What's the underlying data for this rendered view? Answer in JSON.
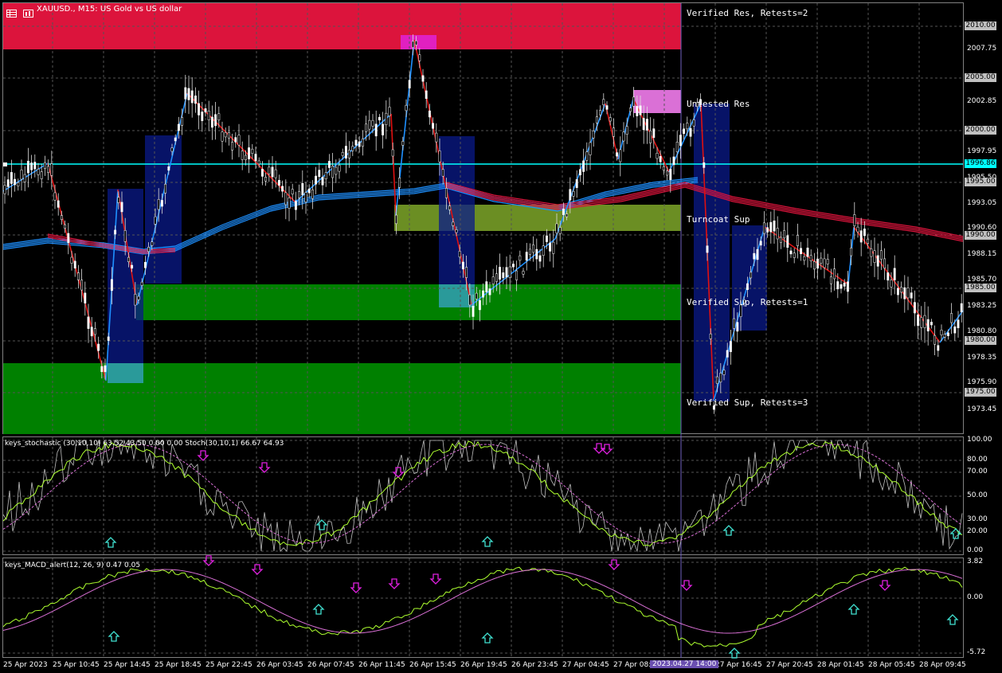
{
  "window": {
    "symbol_title": "XAUUSD., M15:  US Gold vs US dollar",
    "icon_grid": "table-icon",
    "icon_symbol": "chart-icon"
  },
  "colors": {
    "background": "#000000",
    "resistance_zone": "#dc143c",
    "untested_res": "#da70d6",
    "support_zone": "#008000",
    "turncoat_zone": "#6b8e23",
    "zigzag_up": "#1e90ff",
    "zigzag_down": "#e01010",
    "cyan_line": "#00ffff",
    "ma_blue": "#1e90ff",
    "ma_red": "#dc143c",
    "blue_box": "#0a1a8a"
  },
  "zones": {
    "verified_res": "Verified Res, Retests=2",
    "untested_res": "Untested Res",
    "turncoat_sup": "Turncoat Sup",
    "verified_sup_1": "Verified Sup, Retests=1",
    "verified_sup_3": "Verified Sup, Retests=3"
  },
  "price_axis": {
    "ticks": [
      "2010.00",
      "2007.75",
      "2005.00",
      "2002.85",
      "2000.00",
      "1997.95",
      "1995.50",
      "1995.00",
      "1993.05",
      "1990.60",
      "1990.00",
      "1988.15",
      "1985.70",
      "1985.00",
      "1983.25",
      "1980.80",
      "1980.00",
      "1978.35",
      "1975.90",
      "1975.00",
      "1973.45"
    ],
    "boxes": [
      {
        "label": "2010.00",
        "color": "#c0c0c0"
      },
      {
        "label": "2005.00",
        "color": "#c0c0c0"
      },
      {
        "label": "2000.00",
        "color": "#c0c0c0"
      },
      {
        "label": "1996.86",
        "color": "#00ffff"
      },
      {
        "label": "1995.00",
        "color": "#c0c0c0"
      },
      {
        "label": "1990.00",
        "color": "#c0c0c0"
      },
      {
        "label": "1985.00",
        "color": "#c0c0c0"
      },
      {
        "label": "1980.00",
        "color": "#c0c0c0"
      },
      {
        "label": "1975.00",
        "color": "#c0c0c0"
      }
    ]
  },
  "stochastic": {
    "header": "keys_stochastic (30,10,10) 63.52 43.50 0.00 0.00 Stoch(30,10,1) 66.67 64.93",
    "levels": [
      "100.00",
      "80.00",
      "70.00",
      "50.00",
      "30.00",
      "20.00",
      "0.00"
    ]
  },
  "macd": {
    "header": "keys_MACD_alert(12, 26, 9) 0.47 0.05",
    "levels": [
      "3.82",
      "0.00",
      "-5.72"
    ]
  },
  "time_axis": {
    "labels": [
      "25 Apr 2023",
      "25 Apr 10:45",
      "25 Apr 14:45",
      "25 Apr 18:45",
      "25 Apr 22:45",
      "26 Apr 03:45",
      "26 Apr 07:45",
      "26 Apr 11:45",
      "26 Apr 15:45",
      "26 Apr 19:45",
      "26 Apr 23:45",
      "27 Apr 04:45",
      "27 Apr 08:45",
      "27 Apr 16:45",
      "27 Apr 20:45",
      "28 Apr 01:45",
      "28 Apr 05:45",
      "28 Apr 09:45"
    ],
    "cursor": "2023.04.27 14:00"
  }
}
